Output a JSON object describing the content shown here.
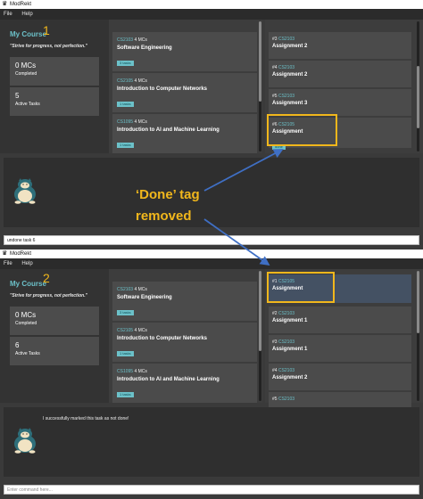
{
  "app": {
    "title": "ModRekt",
    "menu": [
      "File",
      "Help"
    ]
  },
  "annotation": {
    "line1": "‘Done’ tag",
    "line2": "removed"
  },
  "screens": [
    {
      "step": "1",
      "sidebar": {
        "course": "My Course",
        "motto": "\"Strive for progress, not perfection.\"",
        "mcs": {
          "value": "0 MCs",
          "label": "Completed"
        },
        "tasks": {
          "value": "5",
          "label": "Active Tasks"
        }
      },
      "modules": [
        {
          "code": "CS2103",
          "mcs": "4 MCs",
          "title": "Software Engineering",
          "tag": "3 tasks"
        },
        {
          "code": "CS2105",
          "mcs": "4 MCs",
          "title": "Introduction to Computer Networks",
          "tag": "1 tasks"
        },
        {
          "code": "CS1095",
          "mcs": "4 MCs",
          "title": "Introduction to AI and Machine Learning",
          "tag": "1 tasks"
        }
      ],
      "tasks": [
        {
          "num": "#3",
          "code": "CS2103",
          "title": "Assignment 2",
          "tag": ""
        },
        {
          "num": "#4",
          "code": "CS2103",
          "title": "Assignment 2",
          "tag": ""
        },
        {
          "num": "#5",
          "code": "CS2103",
          "title": "Assignment 3",
          "tag": ""
        },
        {
          "num": "#6",
          "code": "CS2105",
          "title": "Assignment",
          "tag": "done"
        }
      ],
      "result": "",
      "command": {
        "value": "undone task 6",
        "placeholder": ""
      }
    },
    {
      "step": "2",
      "sidebar": {
        "course": "My Course",
        "motto": "\"Strive for progress, not perfection.\"",
        "mcs": {
          "value": "0 MCs",
          "label": "Completed"
        },
        "tasks": {
          "value": "6",
          "label": "Active Tasks"
        }
      },
      "modules": [
        {
          "code": "CS2103",
          "mcs": "4 MCs",
          "title": "Software Engineering",
          "tag": "3 tasks"
        },
        {
          "code": "CS2105",
          "mcs": "4 MCs",
          "title": "Introduction to Computer Networks",
          "tag": "1 tasks"
        },
        {
          "code": "CS1095",
          "mcs": "4 MCs",
          "title": "Introduction to AI and Machine Learning",
          "tag": "1 tasks"
        }
      ],
      "tasks": [
        {
          "num": "#1",
          "code": "CS2105",
          "title": "Assignment",
          "tag": ""
        },
        {
          "num": "#2",
          "code": "CS2103",
          "title": "Assignment 1",
          "tag": ""
        },
        {
          "num": "#3",
          "code": "CS2103",
          "title": "Assignment 1",
          "tag": ""
        },
        {
          "num": "#4",
          "code": "CS2103",
          "title": "Assignment 2",
          "tag": ""
        },
        {
          "num": "#5",
          "code": "CS2103",
          "title": "",
          "tag": ""
        }
      ],
      "result": "I successfully marked this task as not done!",
      "command": {
        "value": "",
        "placeholder": "Enter command here..."
      }
    }
  ],
  "colors": {
    "accent": "#6cc1c9",
    "highlight": "#f1b71c",
    "arrow": "#3f6fc4",
    "panel": "#3a3a3a"
  }
}
